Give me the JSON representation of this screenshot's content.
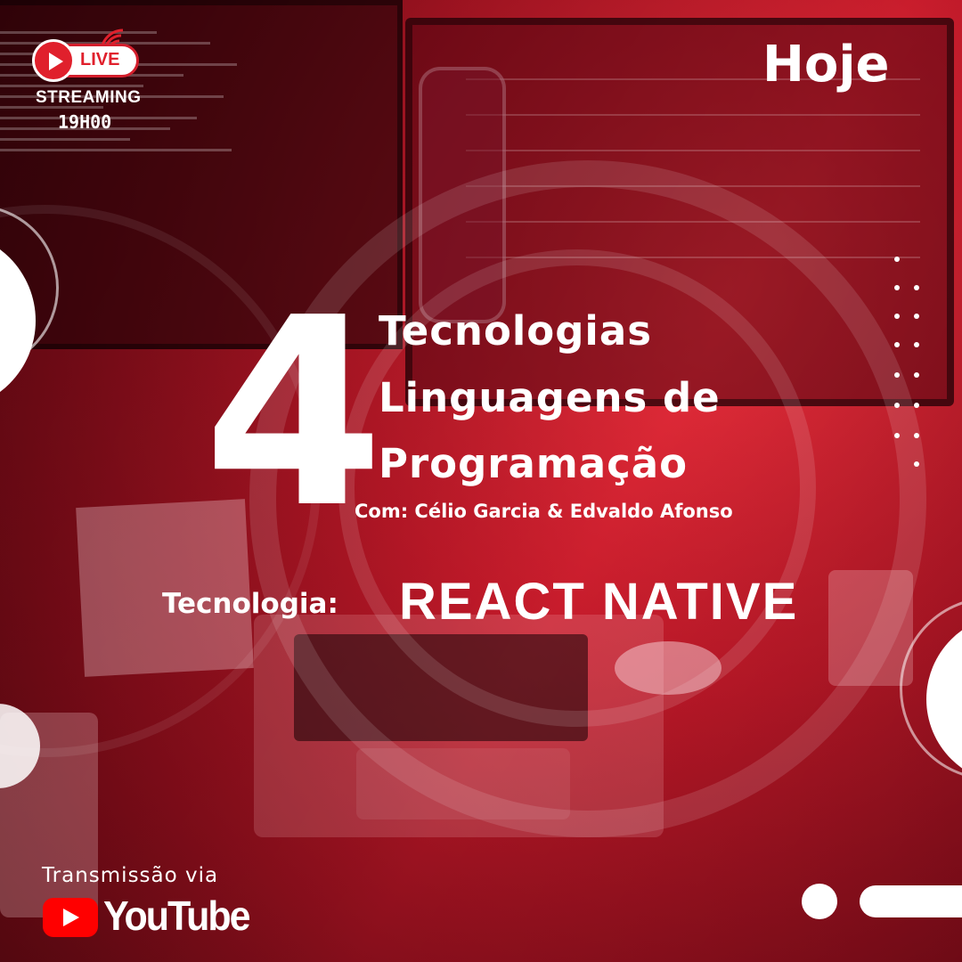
{
  "badge": {
    "live_label": "LIVE",
    "streaming_label": "STREAMING",
    "time": "19H00"
  },
  "header": {
    "day_label": "Hoje"
  },
  "headline": {
    "number": "4",
    "line1": "Tecnologias",
    "line2": "Linguagens de",
    "line3": "Programação",
    "hosts": "Com: Célio Garcia & Edvaldo Afonso"
  },
  "technology": {
    "label": "Tecnologia:",
    "name": "REACT NATIVE"
  },
  "footer": {
    "transmission_label": "Transmissão via",
    "platform": "YouTube"
  },
  "colors": {
    "primary_red": "#d41e2c",
    "youtube_red": "#ff0000",
    "text": "#ffffff"
  },
  "icons": [
    "live-play-icon",
    "broadcast-waves-icon",
    "youtube-play-icon"
  ]
}
